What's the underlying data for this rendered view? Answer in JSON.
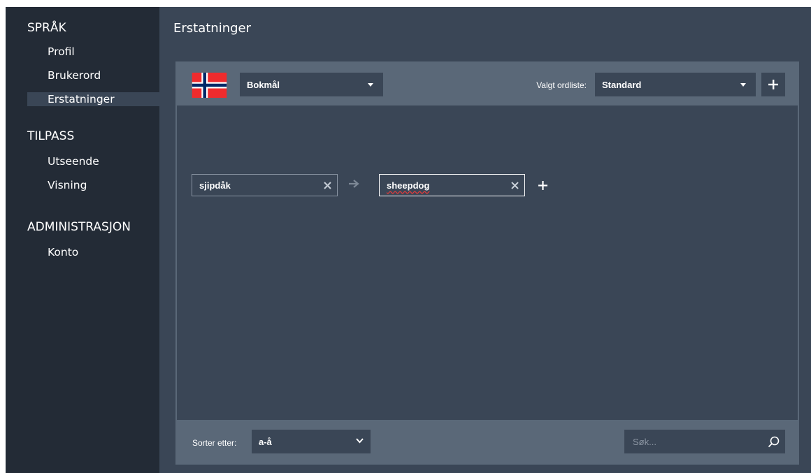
{
  "sidebar": {
    "sections": [
      {
        "title": "SPRÅK",
        "items": [
          "Profil",
          "Brukerord",
          "Erstatninger"
        ]
      },
      {
        "title": "TILPASS",
        "items": [
          "Utseende",
          "Visning"
        ]
      },
      {
        "title": "ADMINISTRASJON",
        "items": [
          "Konto"
        ]
      }
    ],
    "active_item": "Erstatninger"
  },
  "page": {
    "title": "Erstatninger"
  },
  "toolbar": {
    "language_value": "Bokmål",
    "wordlist_label": "Valgt ordliste:",
    "wordlist_value": "Standard",
    "add_icon": "plus-icon",
    "flag_icon": "norway-flag-icon"
  },
  "replacement": {
    "from_value": "sjipdåk",
    "to_value": "sheepdog",
    "arrow_icon": "arrow-right-icon",
    "clear_icon": "close-icon",
    "add_icon": "plus-icon"
  },
  "footer": {
    "sort_label": "Sorter etter:",
    "sort_value": "a-å",
    "search_placeholder": "Søk...",
    "search_icon": "search-icon"
  },
  "colors": {
    "sidebar_bg": "#232b36",
    "content_bg": "#3a4656",
    "panel_bg": "#5a6878",
    "flag_red": "#ef2b2d",
    "flag_blue": "#002868"
  }
}
